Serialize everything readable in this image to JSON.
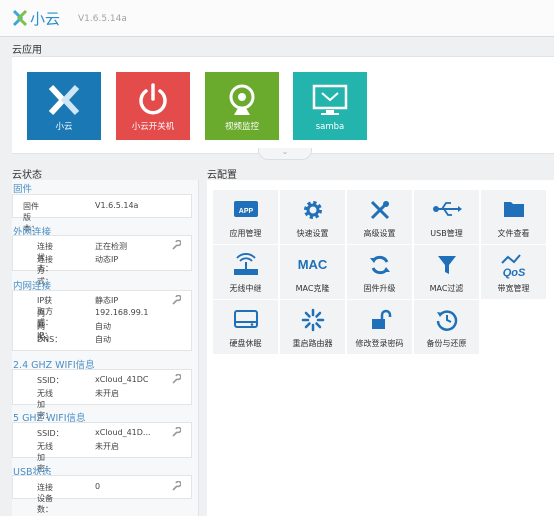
{
  "header": {
    "logo_text": "小云",
    "version": "V1.6.5.14a"
  },
  "apps": {
    "title": "云应用",
    "tiles": [
      {
        "label": "小云",
        "color": "#1a78b4",
        "icon": "xiaoyun-logo-icon"
      },
      {
        "label": "小云开关机",
        "color": "#e44b4b",
        "icon": "power-icon"
      },
      {
        "label": "视频监控",
        "color": "#6aaa2c",
        "icon": "webcam-icon"
      },
      {
        "label": "samba",
        "color": "#23b4ad",
        "icon": "monitor-icon"
      }
    ]
  },
  "status": {
    "title": "云状态",
    "firmware": {
      "title": "固件",
      "rows": [
        {
          "k": "固件版本：",
          "v": "V1.6.5.14a"
        }
      ]
    },
    "wan": {
      "title": "外网连接",
      "rows": [
        {
          "k": "连接状态：",
          "v": "正在检测"
        },
        {
          "k": "连接方式：",
          "v": "动态IP"
        }
      ]
    },
    "lan": {
      "title": "内网连接",
      "rows": [
        {
          "k": "IP获取方式：",
          "v": "静态IP"
        },
        {
          "k": "内网IP：",
          "v": "192.168.99.1"
        },
        {
          "k": "网关：",
          "v": "自动"
        },
        {
          "k": "DNS：",
          "v": "自动"
        }
      ]
    },
    "wifi24": {
      "title": "2.4 GHZ WIFI信息",
      "rows": [
        {
          "k": "SSID：",
          "v": "xCloud_41DC"
        },
        {
          "k": "无线加密：",
          "v": "未开启"
        }
      ]
    },
    "wifi5": {
      "title": "5 GHZ WIFI信息",
      "rows": [
        {
          "k": "SSID：",
          "v": "xCloud_41D..."
        },
        {
          "k": "无线加密：",
          "v": "未开启"
        }
      ]
    },
    "usb": {
      "title": "USB状态",
      "rows": [
        {
          "k": "连接设备数：",
          "v": "0"
        }
      ]
    }
  },
  "config": {
    "title": "云配置",
    "accent": "#1f70b8",
    "items": [
      {
        "label": "应用管理",
        "icon": "app-icon"
      },
      {
        "label": "快速设置",
        "icon": "gear-icon"
      },
      {
        "label": "高级设置",
        "icon": "tools-icon"
      },
      {
        "label": "USB管理",
        "icon": "usb-icon"
      },
      {
        "label": "文件查看",
        "icon": "folder-icon"
      },
      {
        "label": "无线中继",
        "icon": "wireless-router-icon"
      },
      {
        "label": "MAC克隆",
        "icon": "mac-text-icon",
        "icon_text": "MAC"
      },
      {
        "label": "固件升级",
        "icon": "refresh-icon"
      },
      {
        "label": "MAC过滤",
        "icon": "filter-icon"
      },
      {
        "label": "带宽管理",
        "icon": "qos-icon",
        "icon_text": "QoS"
      },
      {
        "label": "硬盘休眠",
        "icon": "harddisk-icon"
      },
      {
        "label": "重启路由器",
        "icon": "spinner-icon"
      },
      {
        "label": "修改登录密码",
        "icon": "unlock-icon"
      },
      {
        "label": "备份与还原",
        "icon": "history-icon"
      }
    ]
  }
}
